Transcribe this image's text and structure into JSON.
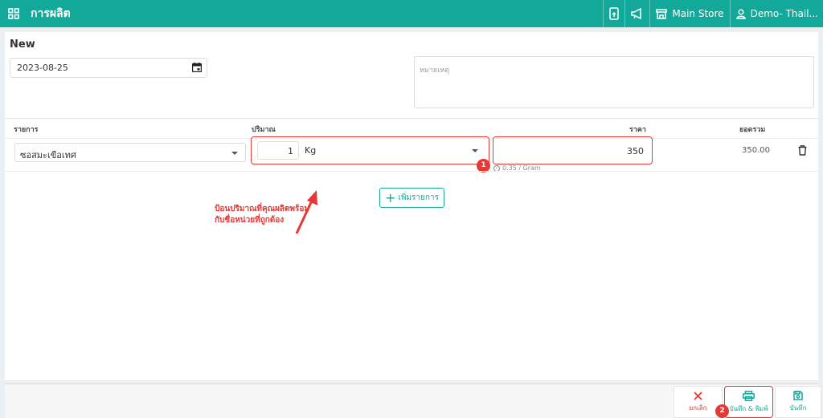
{
  "header": {
    "title": "การผลิต",
    "store_label": "Main Store",
    "user_label": "Demo- Thail..."
  },
  "form": {
    "heading": "New",
    "date_value": "2023-08-25",
    "note_placeholder": "หมายเหตุ"
  },
  "table": {
    "col_item": "รายการ",
    "col_qty": "ปริมาณ",
    "col_price": "ราคา",
    "col_total": "ยอดรวม",
    "rows": [
      {
        "item": "ซอสมะเขือเทศ",
        "qty": "1",
        "unit": "Kg",
        "price": "350",
        "unit_hint": "0.35 / Gram",
        "total": "350.00"
      }
    ]
  },
  "add_item_label": "เพิ่มรายการ",
  "annotation": {
    "text_line1": "ป้อนปริมาณที่คุณผลิตพร้อม",
    "text_line2": "กับชื่อหน่วยที่ถูกต้อง",
    "badge1": "1",
    "badge2": "2",
    "color": "#e53935"
  },
  "footer": {
    "cancel_label": "ยกเลิก",
    "save_print_label": "บันทึก & พิมพ์",
    "save_label": "บันทึก"
  },
  "colors": {
    "brand": "#12a89a",
    "danger": "#e53935"
  }
}
